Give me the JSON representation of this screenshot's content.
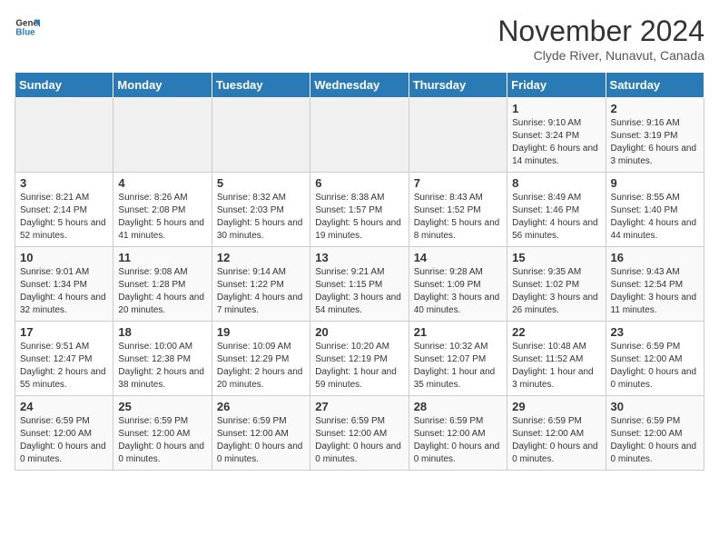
{
  "header": {
    "logo_general": "General",
    "logo_blue": "Blue",
    "month_title": "November 2024",
    "subtitle": "Clyde River, Nunavut, Canada"
  },
  "days_of_week": [
    "Sunday",
    "Monday",
    "Tuesday",
    "Wednesday",
    "Thursday",
    "Friday",
    "Saturday"
  ],
  "weeks": [
    [
      {
        "day": "",
        "info": ""
      },
      {
        "day": "",
        "info": ""
      },
      {
        "day": "",
        "info": ""
      },
      {
        "day": "",
        "info": ""
      },
      {
        "day": "",
        "info": ""
      },
      {
        "day": "1",
        "info": "Sunrise: 9:10 AM\nSunset: 3:24 PM\nDaylight: 6 hours and 14 minutes."
      },
      {
        "day": "2",
        "info": "Sunrise: 9:16 AM\nSunset: 3:19 PM\nDaylight: 6 hours and 3 minutes."
      }
    ],
    [
      {
        "day": "3",
        "info": "Sunrise: 8:21 AM\nSunset: 2:14 PM\nDaylight: 5 hours and 52 minutes."
      },
      {
        "day": "4",
        "info": "Sunrise: 8:26 AM\nSunset: 2:08 PM\nDaylight: 5 hours and 41 minutes."
      },
      {
        "day": "5",
        "info": "Sunrise: 8:32 AM\nSunset: 2:03 PM\nDaylight: 5 hours and 30 minutes."
      },
      {
        "day": "6",
        "info": "Sunrise: 8:38 AM\nSunset: 1:57 PM\nDaylight: 5 hours and 19 minutes."
      },
      {
        "day": "7",
        "info": "Sunrise: 8:43 AM\nSunset: 1:52 PM\nDaylight: 5 hours and 8 minutes."
      },
      {
        "day": "8",
        "info": "Sunrise: 8:49 AM\nSunset: 1:46 PM\nDaylight: 4 hours and 56 minutes."
      },
      {
        "day": "9",
        "info": "Sunrise: 8:55 AM\nSunset: 1:40 PM\nDaylight: 4 hours and 44 minutes."
      }
    ],
    [
      {
        "day": "10",
        "info": "Sunrise: 9:01 AM\nSunset: 1:34 PM\nDaylight: 4 hours and 32 minutes."
      },
      {
        "day": "11",
        "info": "Sunrise: 9:08 AM\nSunset: 1:28 PM\nDaylight: 4 hours and 20 minutes."
      },
      {
        "day": "12",
        "info": "Sunrise: 9:14 AM\nSunset: 1:22 PM\nDaylight: 4 hours and 7 minutes."
      },
      {
        "day": "13",
        "info": "Sunrise: 9:21 AM\nSunset: 1:15 PM\nDaylight: 3 hours and 54 minutes."
      },
      {
        "day": "14",
        "info": "Sunrise: 9:28 AM\nSunset: 1:09 PM\nDaylight: 3 hours and 40 minutes."
      },
      {
        "day": "15",
        "info": "Sunrise: 9:35 AM\nSunset: 1:02 PM\nDaylight: 3 hours and 26 minutes."
      },
      {
        "day": "16",
        "info": "Sunrise: 9:43 AM\nSunset: 12:54 PM\nDaylight: 3 hours and 11 minutes."
      }
    ],
    [
      {
        "day": "17",
        "info": "Sunrise: 9:51 AM\nSunset: 12:47 PM\nDaylight: 2 hours and 55 minutes."
      },
      {
        "day": "18",
        "info": "Sunrise: 10:00 AM\nSunset: 12:38 PM\nDaylight: 2 hours and 38 minutes."
      },
      {
        "day": "19",
        "info": "Sunrise: 10:09 AM\nSunset: 12:29 PM\nDaylight: 2 hours and 20 minutes."
      },
      {
        "day": "20",
        "info": "Sunrise: 10:20 AM\nSunset: 12:19 PM\nDaylight: 1 hour and 59 minutes."
      },
      {
        "day": "21",
        "info": "Sunrise: 10:32 AM\nSunset: 12:07 PM\nDaylight: 1 hour and 35 minutes."
      },
      {
        "day": "22",
        "info": "Sunrise: 10:48 AM\nSunset: 11:52 AM\nDaylight: 1 hour and 3 minutes."
      },
      {
        "day": "23",
        "info": "Sunrise: 6:59 PM\nSunset: 12:00 AM\nDaylight: 0 hours and 0 minutes."
      }
    ],
    [
      {
        "day": "24",
        "info": "Sunrise: 6:59 PM\nSunset: 12:00 AM\nDaylight: 0 hours and 0 minutes."
      },
      {
        "day": "25",
        "info": "Sunrise: 6:59 PM\nSunset: 12:00 AM\nDaylight: 0 hours and 0 minutes."
      },
      {
        "day": "26",
        "info": "Sunrise: 6:59 PM\nSunset: 12:00 AM\nDaylight: 0 hours and 0 minutes."
      },
      {
        "day": "27",
        "info": "Sunrise: 6:59 PM\nSunset: 12:00 AM\nDaylight: 0 hours and 0 minutes."
      },
      {
        "day": "28",
        "info": "Sunrise: 6:59 PM\nSunset: 12:00 AM\nDaylight: 0 hours and 0 minutes."
      },
      {
        "day": "29",
        "info": "Sunrise: 6:59 PM\nSunset: 12:00 AM\nDaylight: 0 hours and 0 minutes."
      },
      {
        "day": "30",
        "info": "Sunrise: 6:59 PM\nSunset: 12:00 AM\nDaylight: 0 hours and 0 minutes."
      }
    ]
  ]
}
